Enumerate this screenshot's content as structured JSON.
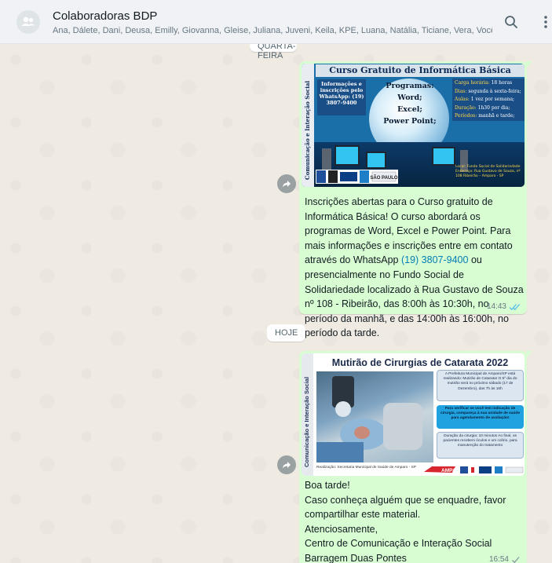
{
  "header": {
    "group_name": "Colaboradoras BDP",
    "members": "Ana, Dálete, Dani, Deusa, Emilly, Giovanna, Gleise, Juliana, Juveni, Keila, KPE, Luana, Natália, Ticiane, Vera, Você",
    "search_icon": "search-icon",
    "menu_icon": "kebab-menu-icon"
  },
  "chat": {
    "date_top": "QUARTA-FEIRA",
    "date_today": "HOJE",
    "messages": [
      {
        "poster": {
          "title": "Curso Gratuito de Informática Básica",
          "side": "Comunicação e Interação Social",
          "info": "Informações e inscrições pelo WhatsApp: (19) 3807-9400",
          "programs_label": "Programas:",
          "programs": [
            "Word;",
            "Excel;",
            "Power Point;"
          ],
          "hours": [
            {
              "k": "Carga horária:",
              "v": "18 horas"
            },
            {
              "k": "Dias:",
              "v": "segunda à sexta-feira;"
            },
            {
              "k": "Aulas:",
              "v": "1 vez por semana;"
            },
            {
              "k": "Duração:",
              "v": "1h30 por dia;"
            },
            {
              "k": "Períodos:",
              "v": "manhã e tarde;"
            }
          ],
          "local": "Local: Fundo Social de Solidariedade Endereço: Rua Gustavo de Souza, nº 108 Ribeirão – Amparo - SP",
          "logo_text": "SÃO PAULO"
        },
        "text_before_link": "Inscrições abertas para o Curso gratuito de Informática Básica!  O curso abordará os programas de Word, Excel e Power Point. Para mais informações e inscrições entre em contato através do WhatsApp ",
        "link": "(19) 3807-9400",
        "text_after_link": " ou presencialmente no Fundo Social de Solidariedade localizado à Rua Gustavo de Souza nº 108 - Ribeirão, das 8:00h às 10:30h, no período da manhã, e das 14:00h às 16:00h, no período da tarde.",
        "time": "14:43",
        "status": "read"
      },
      {
        "poster": {
          "title": "Mutirão de Cirurgias de Catarata 2022",
          "side": "Comunicação e Interação Social",
          "box1": "A Prefeitura Municipal de Amparo/SP está realizando: Mutirão de Catarata! O 5º dia do mutirão será no próximo sábado (17 de Dezembro), das 7h às 16h",
          "box2": "Para verificar se você tem indicação de cirurgia, compareça à sua unidade de saúde para agendamento de avaliação!",
          "box3": "Duração da cirurgia: 10 minutos Ao final, os pacientes recebem óculos e um colírio, para manutenção do tratamento",
          "footer": "Realização: Secretaria Municipal de Saúde de Amparo - SP",
          "logo_text": "AMPARO"
        },
        "lines": [
          "Boa tarde!",
          "Caso conheça alguém que se enquadre, favor compartilhar este material.",
          "Atenciosamente,",
          "Centro de Comunicação e Interação Social",
          "Barragem Duas Pontes"
        ],
        "time": "16:54",
        "status": "sent"
      }
    ]
  },
  "colors": {
    "bubble": "#d9fdd3",
    "link": "#027eb5",
    "read_ticks": "#53bdeb",
    "header_bg": "#f0f2f5"
  }
}
